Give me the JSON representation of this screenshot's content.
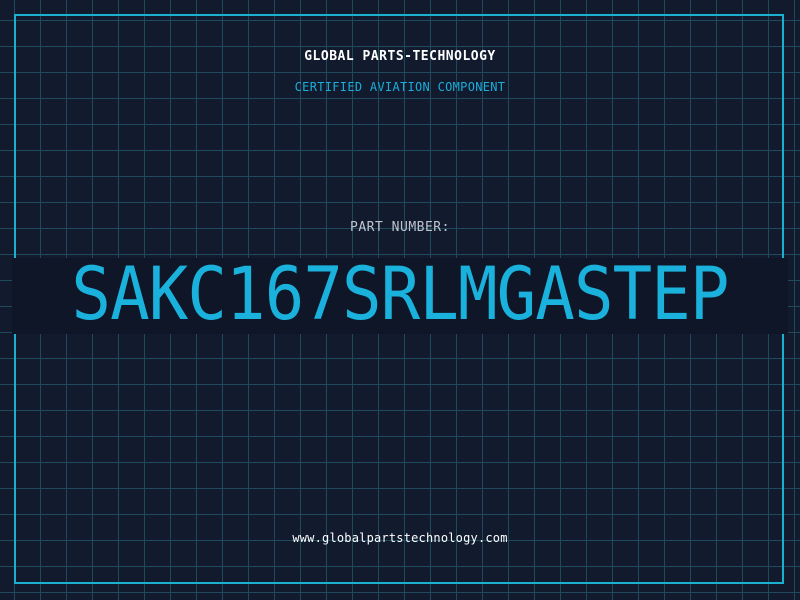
{
  "header": {
    "company": "GLOBAL PARTS-TECHNOLOGY",
    "subtitle": "CERTIFIED AVIATION COMPONENT"
  },
  "part": {
    "label": "PART NUMBER:",
    "number": "SAKC167SRLMGASTEP"
  },
  "footer": {
    "website": "www.globalpartstechnology.com"
  },
  "colors": {
    "background": "#121a2e",
    "grid": "#1e4a5c",
    "accent": "#1ab2dc",
    "text": "#ffffff"
  }
}
